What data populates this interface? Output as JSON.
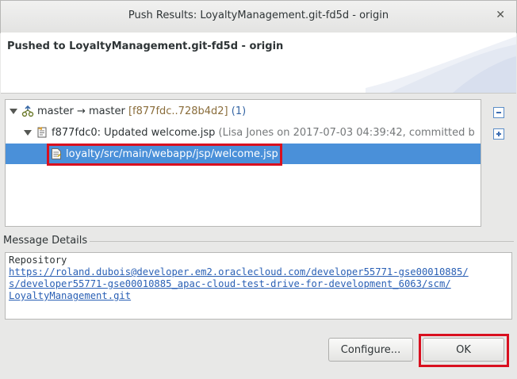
{
  "window": {
    "title": "Push Results: LoyaltyManagement.git-fd5d - origin",
    "close_glyph": "✕"
  },
  "header": {
    "message": "Pushed to LoyaltyManagement.git-fd5d - origin"
  },
  "tree": {
    "ref_row": {
      "name": "master → master",
      "range": "[f877fdc..728b4d2]",
      "count": "(1)",
      "icon": "git-push-icon"
    },
    "commit_row": {
      "title": "f877fdc0: Updated welcome.jsp",
      "meta": "(Lisa Jones on 2017-07-03 04:39:42, committed b",
      "icon": "git-commit-icon"
    },
    "file_row": {
      "path": "loyalty/src/main/webapp/jsp/welcome.jsp",
      "icon": "file-icon"
    }
  },
  "side_buttons": {
    "collapse": "collapse-all-icon",
    "expand": "expand-all-icon"
  },
  "message_details": {
    "label": "Message Details",
    "line1": "Repository",
    "link_line1": "https://roland.dubois@developer.em2.oraclecloud.com/developer55771-gse00010885/",
    "link_line2": "s/developer55771-gse00010885_apac-cloud-test-drive-for-development_6063/scm/",
    "link_line3": "LoyaltyManagement.git"
  },
  "buttons": {
    "configure": "Configure...",
    "ok": "OK"
  },
  "colors": {
    "selection": "#4a90d9",
    "highlight_box": "#d9101f",
    "link": "#2a60b5"
  }
}
